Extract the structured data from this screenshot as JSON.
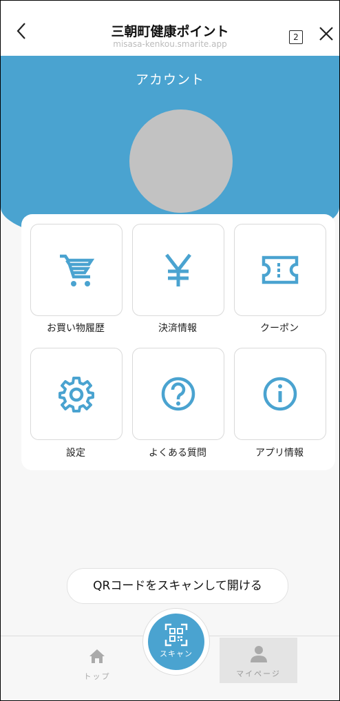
{
  "browser": {
    "title": "三朝町健康ポイント",
    "url": "misasa-kenkou.smarite.app",
    "tab_count": "2",
    "back_icon": "chevron-left-icon",
    "close_icon": "close-icon"
  },
  "account": {
    "heading": "アカウント",
    "accent_color": "#4aa3d0"
  },
  "menu": [
    {
      "label": "お買い物履歴",
      "icon": "cart-icon"
    },
    {
      "label": "決済情報",
      "icon": "yen-icon"
    },
    {
      "label": "クーポン",
      "icon": "ticket-icon"
    },
    {
      "label": "設定",
      "icon": "gear-icon"
    },
    {
      "label": "よくある質問",
      "icon": "question-icon"
    },
    {
      "label": "アプリ情報",
      "icon": "info-icon"
    }
  ],
  "qr_button": {
    "label": "QRコードをスキャンして開ける"
  },
  "bottom_nav": {
    "home": {
      "label": "トップ",
      "icon": "home-icon"
    },
    "scan": {
      "label": "スキャン",
      "icon": "qr-code-icon"
    },
    "mypage": {
      "label": "マイページ",
      "icon": "person-icon",
      "active": true
    }
  }
}
